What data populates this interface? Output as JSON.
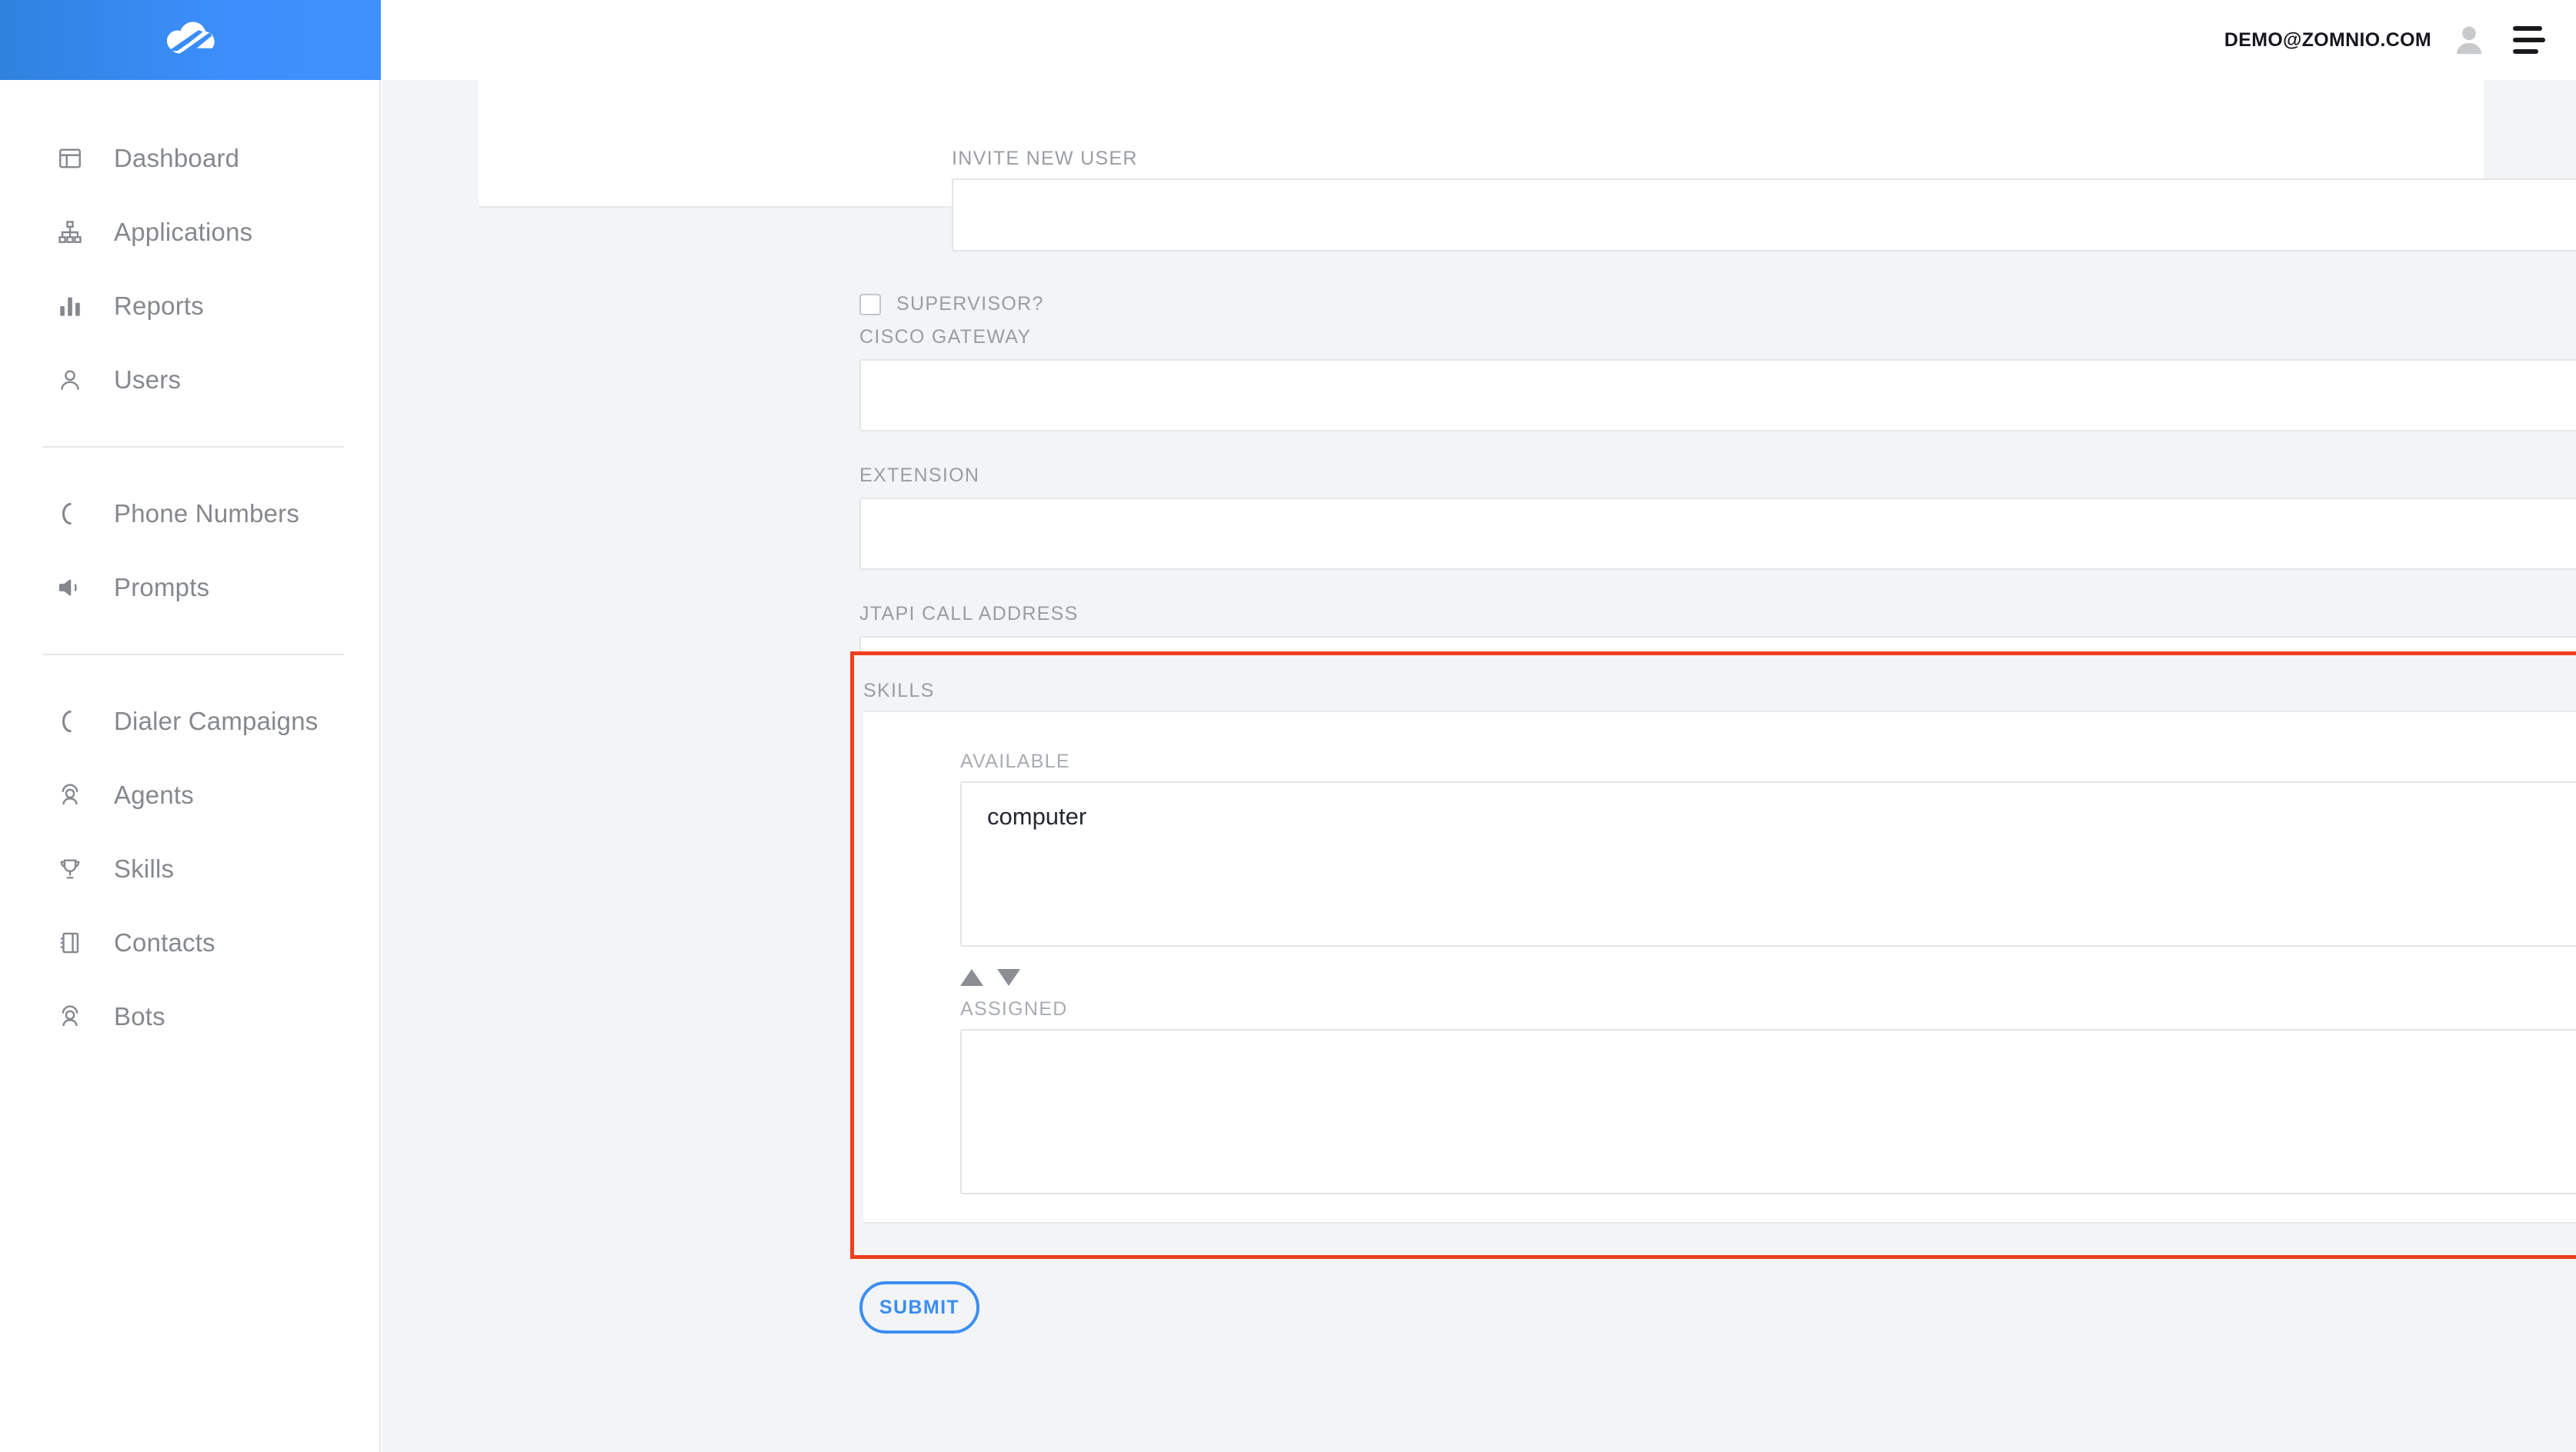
{
  "brand": {
    "logo_icon": "cloud-bolt-logo",
    "header_color": "#3b8ffc"
  },
  "topbar": {
    "user_email": "DEMO@ZOMNIO.COM",
    "avatar_icon": "user-avatar-icon",
    "menu_icon": "hamburger-menu-icon"
  },
  "sidebar": {
    "groups": [
      {
        "items": [
          {
            "label": "Dashboard",
            "icon": "dashboard-icon"
          },
          {
            "label": "Applications",
            "icon": "sitemap-icon"
          },
          {
            "label": "Reports",
            "icon": "bar-chart-icon"
          },
          {
            "label": "Users",
            "icon": "user-icon"
          }
        ]
      },
      {
        "items": [
          {
            "label": "Phone Numbers",
            "icon": "phone-icon"
          },
          {
            "label": "Prompts",
            "icon": "speaker-icon"
          }
        ]
      },
      {
        "items": [
          {
            "label": "Dialer Campaigns",
            "icon": "phone-icon"
          },
          {
            "label": "Agents",
            "icon": "headset-icon"
          },
          {
            "label": "Skills",
            "icon": "trophy-icon"
          },
          {
            "label": "Contacts",
            "icon": "address-book-icon"
          },
          {
            "label": "Bots",
            "icon": "headset-icon"
          }
        ]
      }
    ]
  },
  "form": {
    "invite": {
      "label": "INVITE NEW USER",
      "value": "",
      "placeholder": ""
    },
    "supervisor": {
      "label": "SUPERVISOR?",
      "checked": false
    },
    "fields": [
      {
        "label": "CISCO GATEWAY",
        "value": "",
        "placeholder": ""
      },
      {
        "label": "EXTENSION",
        "value": "",
        "placeholder": ""
      },
      {
        "label": "JTAPI CALL ADDRESS",
        "value": "",
        "placeholder": ""
      }
    ],
    "skills": {
      "label": "SKILLS",
      "highlight_color": "#ef3f20",
      "available": {
        "label": "AVAILABLE",
        "options": [
          "computer"
        ]
      },
      "move_up_icon": "triangle-up-icon",
      "move_down_icon": "triangle-down-icon",
      "assigned": {
        "label": "ASSIGNED",
        "options": []
      }
    },
    "submit_label": "SUBMIT",
    "submit_color": "#3b8ef0"
  }
}
